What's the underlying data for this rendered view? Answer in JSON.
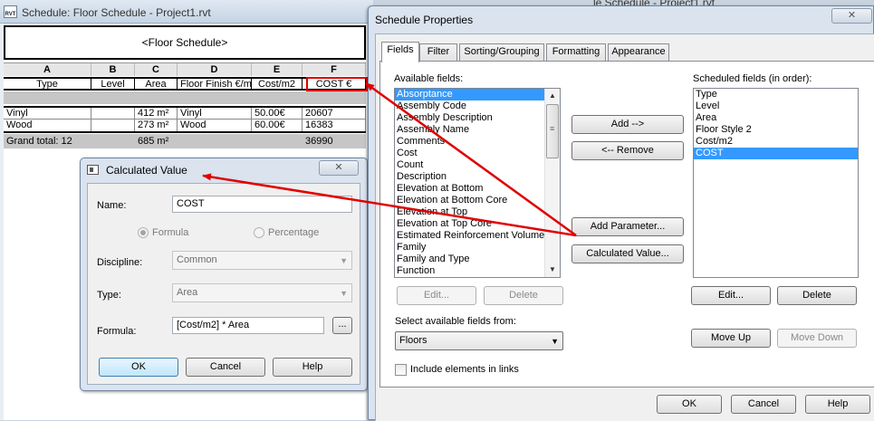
{
  "schedule_window": {
    "icon_text": "RVT",
    "title": "Schedule: Floor Schedule - Project1.rvt",
    "header": "<Floor Schedule>",
    "column_letters": [
      "A",
      "B",
      "C",
      "D",
      "E",
      "F"
    ],
    "column_headers": [
      "Type",
      "Level",
      "Area",
      "Floor Finish €/m",
      "Cost/m2",
      "COST €"
    ],
    "rows": [
      [
        "Vinyl",
        "",
        "412 m²",
        "Vinyl",
        "50.00€",
        "20607"
      ],
      [
        "Wood",
        "",
        "273 m²",
        "Wood",
        "60.00€",
        "16383"
      ]
    ],
    "grand_total": [
      "Grand total: 12",
      "685 m²",
      "36990"
    ]
  },
  "calc_dialog": {
    "title": "Calculated Value",
    "close_glyph": "✕",
    "name_label": "Name:",
    "name_value": "COST",
    "formula_option": "Formula",
    "percentage_option": "Percentage",
    "discipline_label": "Discipline:",
    "discipline_value": "Common",
    "type_label": "Type:",
    "type_value": "Area",
    "formula_label": "Formula:",
    "formula_value": "[Cost/m2] * Area",
    "browse_label": "...",
    "ok_label": "OK",
    "cancel_label": "Cancel",
    "help_label": "Help"
  },
  "props_dialog": {
    "behind_title": "le Schedule - Project1.rvt",
    "title": "Schedule Properties",
    "close_glyph": "✕",
    "tabs": [
      "Fields",
      "Filter",
      "Sorting/Grouping",
      "Formatting",
      "Appearance"
    ],
    "available_label": "Available fields:",
    "available_fields": [
      "Absorptance",
      "Assembly Code",
      "Assembly Description",
      "Assembly Name",
      "Comments",
      "Cost",
      "Count",
      "Description",
      "Elevation at Bottom",
      "Elevation at Bottom Core",
      "Elevation at Top",
      "Elevation at Top Core",
      "Estimated Reinforcement Volume",
      "Family",
      "Family and Type",
      "Function"
    ],
    "scheduled_label": "Scheduled fields (in order):",
    "scheduled_fields": [
      "Type",
      "Level",
      "Area",
      "Floor Style 2",
      "Cost/m2",
      "COST"
    ],
    "add_label": "Add -->",
    "remove_label": "<-- Remove",
    "add_parameter_label": "Add Parameter...",
    "calculated_value_label": "Calculated Value...",
    "edit_left_label": "Edit...",
    "delete_left_label": "Delete",
    "edit_right_label": "Edit...",
    "delete_right_label": "Delete",
    "select_from_label": "Select available fields from:",
    "select_from_value": "Floors",
    "move_up_label": "Move Up",
    "move_down_label": "Move Down",
    "include_links_label": "Include elements in links",
    "ok_label": "OK",
    "cancel_label": "Cancel",
    "help_label": "Help"
  },
  "colors": {
    "annotation": "#e00000",
    "selection": "#3399ff"
  }
}
